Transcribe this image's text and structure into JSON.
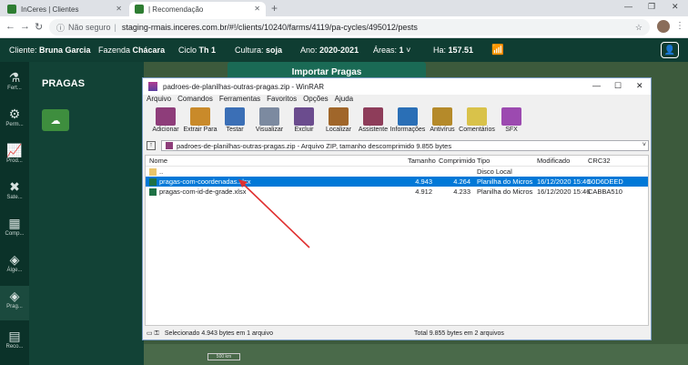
{
  "browser": {
    "tabs": [
      {
        "label": "InCeres | Clientes"
      },
      {
        "label": "| Recomendação"
      }
    ],
    "new_tab": "+",
    "url_prefix": "Não seguro",
    "url": "staging-rmais.inceres.com.br/#!/clients/10240/farms/4119/pa-cycles/495012/pests"
  },
  "appbar": {
    "client_label": "Cliente:",
    "client_value": "Bruna Garcia",
    "farm_label": "Fazenda",
    "farm_value": "Chácara",
    "cycle_label": "Ciclo",
    "cycle_value": "Th 1",
    "crop_label": "Cultura:",
    "crop_value": "soja",
    "year_label": "Ano:",
    "year_value": "2020-2021",
    "areas_label": "Áreas:",
    "areas_value": "1",
    "ha_label": "Ha:",
    "ha_value": "157.51"
  },
  "sidenav": [
    {
      "label": "Fert..."
    },
    {
      "label": "Perm..."
    },
    {
      "label": "Prod..."
    },
    {
      "label": "Sate..."
    },
    {
      "label": "Comp..."
    },
    {
      "label": "Álge..."
    },
    {
      "label": "Prag..."
    },
    {
      "label": "Reco..."
    }
  ],
  "panel": {
    "title": "PRAGAS"
  },
  "import_button": "Importar Pragas",
  "map_scale": "500 km",
  "winrar": {
    "title": "padroes-de-planilhas-outras-pragas.zip - WinRAR",
    "menu": [
      "Arquivo",
      "Comandos",
      "Ferramentas",
      "Favoritos",
      "Opções",
      "Ajuda"
    ],
    "toolbar": [
      {
        "label": "Adicionar",
        "color": "#8e3d7a"
      },
      {
        "label": "Extrair Para",
        "color": "#c98a2a"
      },
      {
        "label": "Testar",
        "color": "#3b6fb6"
      },
      {
        "label": "Visualizar",
        "color": "#7c8aa0"
      },
      {
        "label": "Excluir",
        "color": "#6b4c8e"
      },
      {
        "label": "Localizar",
        "color": "#a0662a"
      },
      {
        "label": "Assistente",
        "color": "#8e3d5a"
      },
      {
        "label": "Informações",
        "color": "#2a6fb6"
      },
      {
        "label": "Antivírus",
        "color": "#b58a2a"
      },
      {
        "label": "Comentários",
        "color": "#d9c24a"
      },
      {
        "label": "SFX",
        "color": "#9c4ab0"
      }
    ],
    "path": "padroes-de-planilhas-outras-pragas.zip - Arquivo ZIP, tamanho descomprimido 9.855 bytes",
    "columns": [
      "Nome",
      "Tamanho",
      "Comprimido",
      "Tipo",
      "Modificado",
      "CRC32"
    ],
    "rows": [
      {
        "name": "..",
        "size": "",
        "comp": "",
        "type": "Disco Local",
        "mod": "",
        "crc": "",
        "icon": "folder"
      },
      {
        "name": "pragas-com-coordenadas.xlsx",
        "size": "4.943",
        "comp": "4.264",
        "type": "Planilha do Micros...",
        "mod": "16/12/2020 15:46",
        "crc": "50D6DEED",
        "icon": "xls",
        "selected": true
      },
      {
        "name": "pragas-com-id-de-grade.xlsx",
        "size": "4.912",
        "comp": "4.233",
        "type": "Planilha do Micros...",
        "mod": "16/12/2020 15:46",
        "crc": "CABBA510",
        "icon": "xls"
      }
    ],
    "status_left": "Selecionado 4.943 bytes em 1 arquivo",
    "status_right": "Total 9.855 bytes em 2 arquivos"
  },
  "colors": {
    "app_bar": "#0f3d32",
    "selection": "#0078d7",
    "arrow": "#e03030"
  }
}
